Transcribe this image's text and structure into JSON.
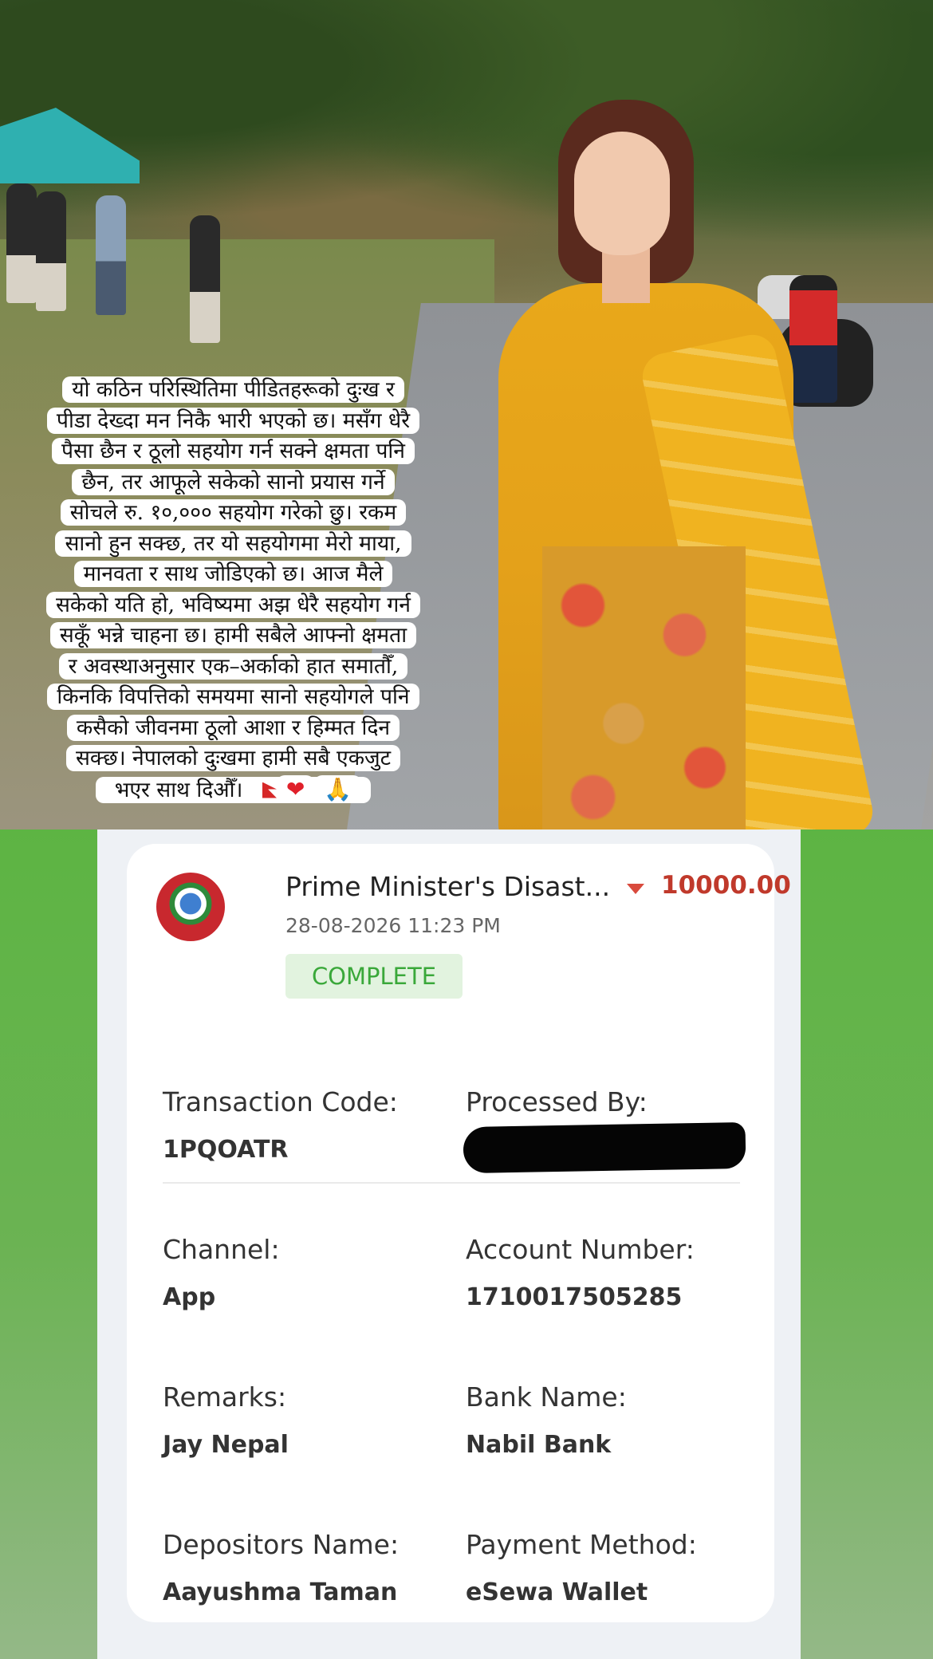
{
  "caption": {
    "lines": [
      "यो कठिन परिस्थितिमा पीडितहरूको दुःख र",
      "पीडा देख्दा मन निकै भारी भएको छ। मसँग धेरै",
      "पैसा छैन र ठूलो सहयोग गर्न सक्ने क्षमता पनि",
      "छैन, तर आफूले सकेको सानो प्रयास गर्ने",
      "सोचले रु. १०,००० सहयोग गरेको छु। रकम",
      "सानो हुन सक्छ, तर यो सहयोगमा मेरो माया,",
      "मानवता र साथ जोडिएको छ। आज मैले",
      "सकेको यति हो, भविष्यमा अझ धेरै सहयोग गर्न",
      "सकूँ भन्ने चाहना छ। हामी सबैले आफ्नो क्षमता",
      "र अवस्थाअनुसार एक–अर्काको हात समातौँ,",
      "किनकि विपत्तिको समयमा सानो सहयोगले पनि",
      "कसैको जीवनमा ठूलो आशा र हिम्मत दिन",
      "सक्छ। नेपालको दुःखमा हामी सबै एकजुट"
    ],
    "last_line": "भएर साथ दिऔँ।",
    "emoji": {
      "flag": "nepal-flag-icon",
      "heart": "❤",
      "pray": "🙏"
    }
  },
  "transaction": {
    "merchant": "Prime Minister's Disast...",
    "amount": "10000.00",
    "datetime": "28-08-2026 11:23 PM",
    "status": "COMPLETE",
    "fields": {
      "transaction_code_label": "Transaction Code:",
      "transaction_code": "1PQOATR",
      "processed_by_label": "Processed By:",
      "channel_label": "Channel:",
      "channel": "App",
      "account_number_label": "Account Number:",
      "account_number": "1710017505285",
      "remarks_label": "Remarks:",
      "remarks": "Jay Nepal",
      "bank_name_label": "Bank Name:",
      "bank_name": "Nabil Bank",
      "depositors_name_label": "Depositors Name:",
      "depositors_name": "Aayushma Taman",
      "payment_method_label": "Payment Method:",
      "payment_method": "eSewa Wallet"
    }
  },
  "colors": {
    "amount": "#c0392b",
    "status_text": "#3aa83a",
    "status_bg": "#e2f3df",
    "background_green": "#5db443"
  }
}
